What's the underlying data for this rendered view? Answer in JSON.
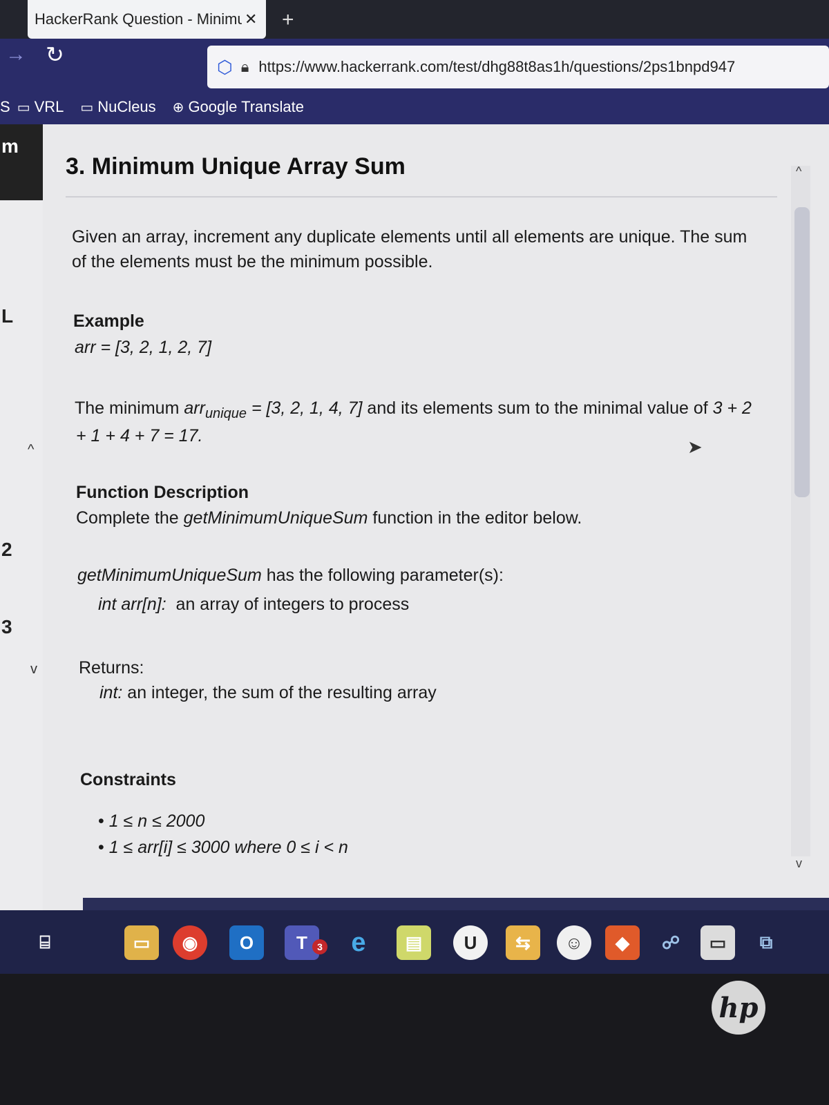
{
  "browser": {
    "tab_title": "HackerRank Question - Minimu",
    "tab_close": "✕",
    "new_tab": "+",
    "url": "https://www.hackerrank.com/test/dhg88t8as1h/questions/2ps1bnpd947",
    "bookmarks": [
      {
        "label": "VRL",
        "icon": "folder-icon"
      },
      {
        "label": "NuCleus",
        "icon": "folder-icon"
      },
      {
        "label": "Google Translate",
        "icon": "globe-icon"
      }
    ]
  },
  "question": {
    "title": "3. Minimum Unique Array Sum",
    "intro_line1": "Given an array, increment any duplicate elements until all elements are unique. The sum",
    "intro_line2": "of the elements must be the minimum possible.",
    "example_heading": "Example",
    "example_arr": "arr = [3, 2, 1, 2, 7]",
    "result_line1_a": "The minimum ",
    "result_line1_var": "arr",
    "result_line1_sub": "unique",
    "result_line1_b": " = [3, 2, 1, 4, 7]",
    "result_line1_c": " and its elements sum to the minimal value of ",
    "result_line1_d": "3 + 2",
    "result_line2": "+ 1 + 4 + 7 = 17.",
    "func_heading": "Function Description",
    "func_desc_a": "Complete the ",
    "func_name": "getMinimumUniqueSum",
    "func_desc_b": " function in the editor below.",
    "params_intro_name": "getMinimumUniqueSum",
    "params_intro_rest": " has the following parameter(s):",
    "param_sig": "int arr[n]:",
    "param_desc": "  an array of integers to process",
    "returns_heading": "Returns:",
    "returns_type": "int:",
    "returns_desc": " an integer, the sum of the resulting array",
    "constraints_heading": "Constraints",
    "constraint1": "1 ≤ n ≤ 2000",
    "constraint2": "1 ≤ arr[i] ≤ 3000 where 0 ≤ i < n"
  },
  "left_marks": [
    "m",
    "L",
    "2",
    "3"
  ],
  "taskbar": {
    "teams_badge": "3",
    "apps": [
      "task-view-icon",
      "file-explorer-icon",
      "chrome-icon",
      "outlook-icon",
      "teams-icon",
      "edge-icon",
      "notepad-icon",
      "ue-icon",
      "folder-transfer-icon",
      "chat-icon",
      "office-icon",
      "network-icon",
      "terminal-icon",
      "remote-icon"
    ]
  },
  "logo_text": "hp"
}
